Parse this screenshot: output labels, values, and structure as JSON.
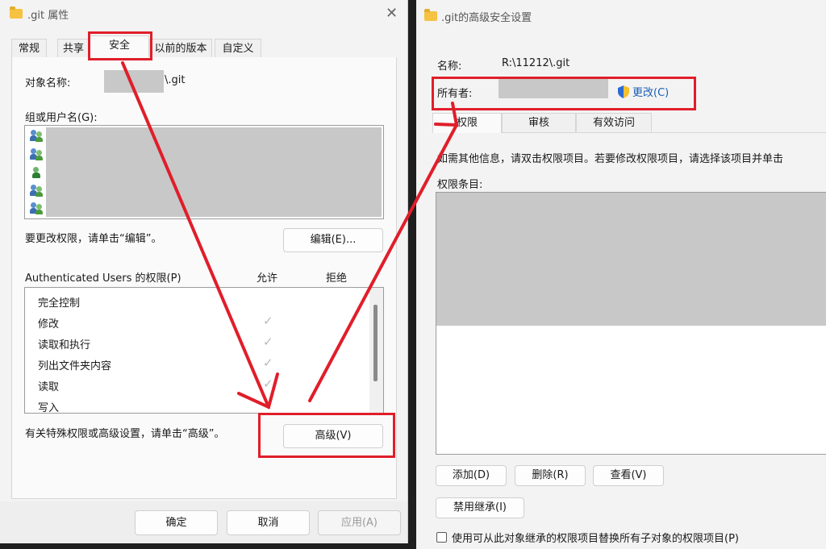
{
  "props_window": {
    "title": ".git 属性",
    "tabs": [
      "常规",
      "共享",
      "安全",
      "以前的版本",
      "自定义"
    ],
    "object_name_label": "对象名称:",
    "object_name_suffix": "\\.git",
    "groups_label": "组或用户名(G):",
    "edit_hint": "要更改权限，请单击“编辑”。",
    "edit_button": "编辑(E)...",
    "perm_header": "Authenticated Users 的权限(P)",
    "allow_header": "允许",
    "deny_header": "拒绝",
    "permissions": [
      {
        "name": "完全控制",
        "allow": false
      },
      {
        "name": "修改",
        "allow": true
      },
      {
        "name": "读取和执行",
        "allow": true
      },
      {
        "name": "列出文件夹内容",
        "allow": true
      },
      {
        "name": "读取",
        "allow": true
      },
      {
        "name": "写入",
        "allow": true
      }
    ],
    "advanced_hint": "有关特殊权限或高级设置，请单击“高级”。",
    "advanced_button": "高级(V)",
    "ok_button": "确定",
    "cancel_button": "取消",
    "apply_button": "应用(A)",
    "close_glyph": "✕"
  },
  "adv_window": {
    "title": ".git的高级安全设置",
    "name_label": "名称:",
    "name_value": "R:\\11212\\.git",
    "owner_label": "所有者:",
    "change_link": "更改(C)",
    "tabs": [
      "权限",
      "审核",
      "有效访问"
    ],
    "info_text": "如需其他信息，请双击权限项目。若要修改权限项目，请选择该项目并单击",
    "entries_label": "权限条目:",
    "add_button": "添加(D)",
    "remove_button": "删除(R)",
    "view_button": "查看(V)",
    "disable_inherit_button": "禁用继承(I)",
    "replace_checkbox_label": "使用可从此对象继承的权限项目替换所有子对象的权限项目(P)"
  },
  "colors": {
    "highlight_red": "#e01e2a",
    "redacted_gray": "#c8c8c8",
    "link_blue": "#1a5fb4"
  }
}
